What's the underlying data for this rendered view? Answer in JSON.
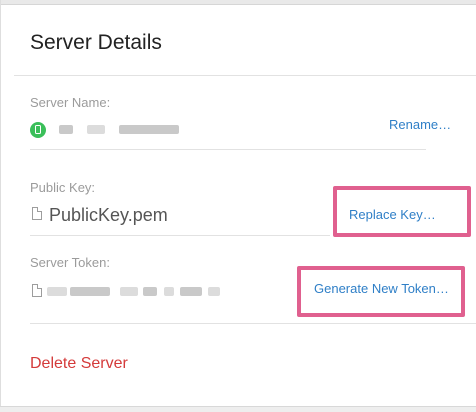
{
  "panel": {
    "title": "Server Details"
  },
  "server_name": {
    "label": "Server Name:",
    "status_icon": "phone-icon",
    "status_color": "#3bbf5a",
    "rename_label": "Rename…"
  },
  "public_key": {
    "label": "Public Key:",
    "file_icon": "document-icon",
    "file_name": "PublicKey.pem",
    "replace_label": "Replace Key…"
  },
  "server_token": {
    "label": "Server Token:",
    "file_icon": "document-icon",
    "generate_label": "Generate New Token…"
  },
  "actions": {
    "delete_label": "Delete Server"
  },
  "colors": {
    "link": "#2f7fc7",
    "danger": "#d43a3a",
    "highlight": "#e0608f"
  }
}
